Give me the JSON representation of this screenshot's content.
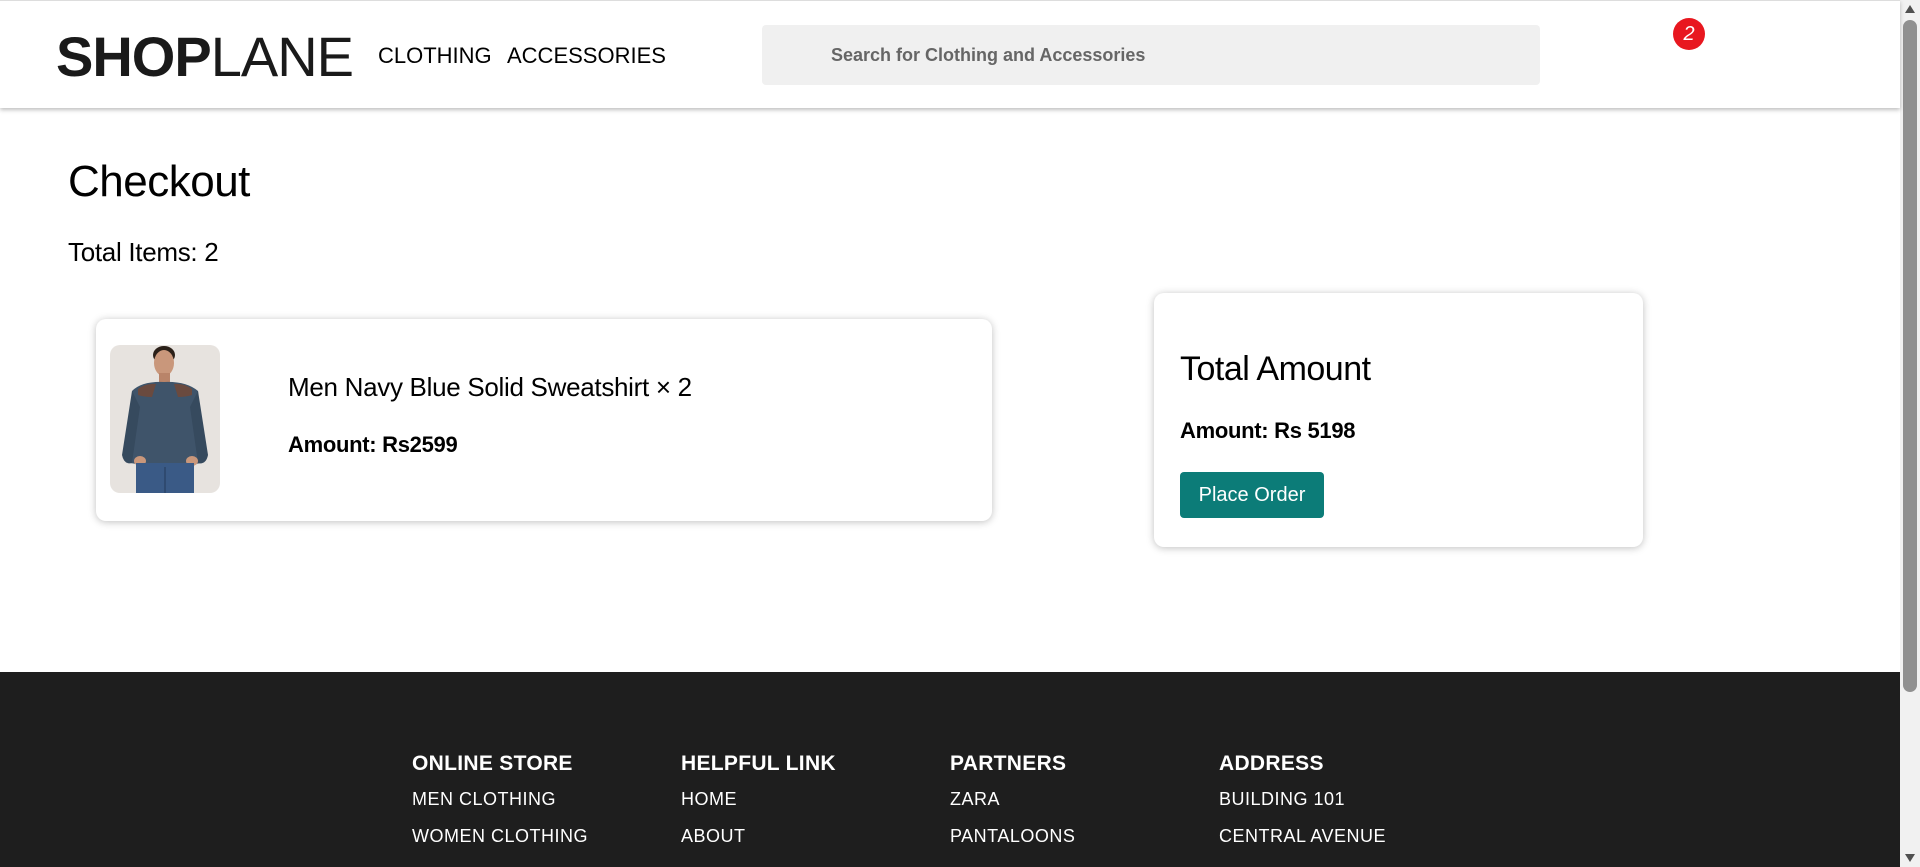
{
  "header": {
    "logo_bold": "SHOP",
    "logo_light": "LANE",
    "nav": [
      "CLOTHING",
      "ACCESSORIES"
    ],
    "search_placeholder": "Search for Clothing and Accessories",
    "cart_count": "2"
  },
  "checkout": {
    "title": "Checkout",
    "total_items": "Total Items: 2",
    "items": [
      {
        "name": "Men Navy Blue Solid Sweatshirt × 2",
        "amount": "Amount: Rs2599"
      }
    ]
  },
  "summary": {
    "title": "Total Amount",
    "amount": "Amount: Rs 5198",
    "button": "Place Order",
    "button_color": "#0c7c78"
  },
  "footer": {
    "columns": [
      {
        "heading": "ONLINE STORE",
        "links": [
          "MEN CLOTHING",
          "WOMEN CLOTHING"
        ]
      },
      {
        "heading": "HELPFUL LINK",
        "links": [
          "HOME",
          "ABOUT"
        ]
      },
      {
        "heading": "PARTNERS",
        "links": [
          "ZARA",
          "PANTALOONS"
        ]
      },
      {
        "heading": "ADDRESS",
        "links": [
          "BUILDING 101",
          "CENTRAL AVENUE"
        ]
      }
    ]
  },
  "colors": {
    "badge": "#e8171f",
    "footer_bg": "#1e1e1e",
    "accent": "#0c7c78"
  }
}
